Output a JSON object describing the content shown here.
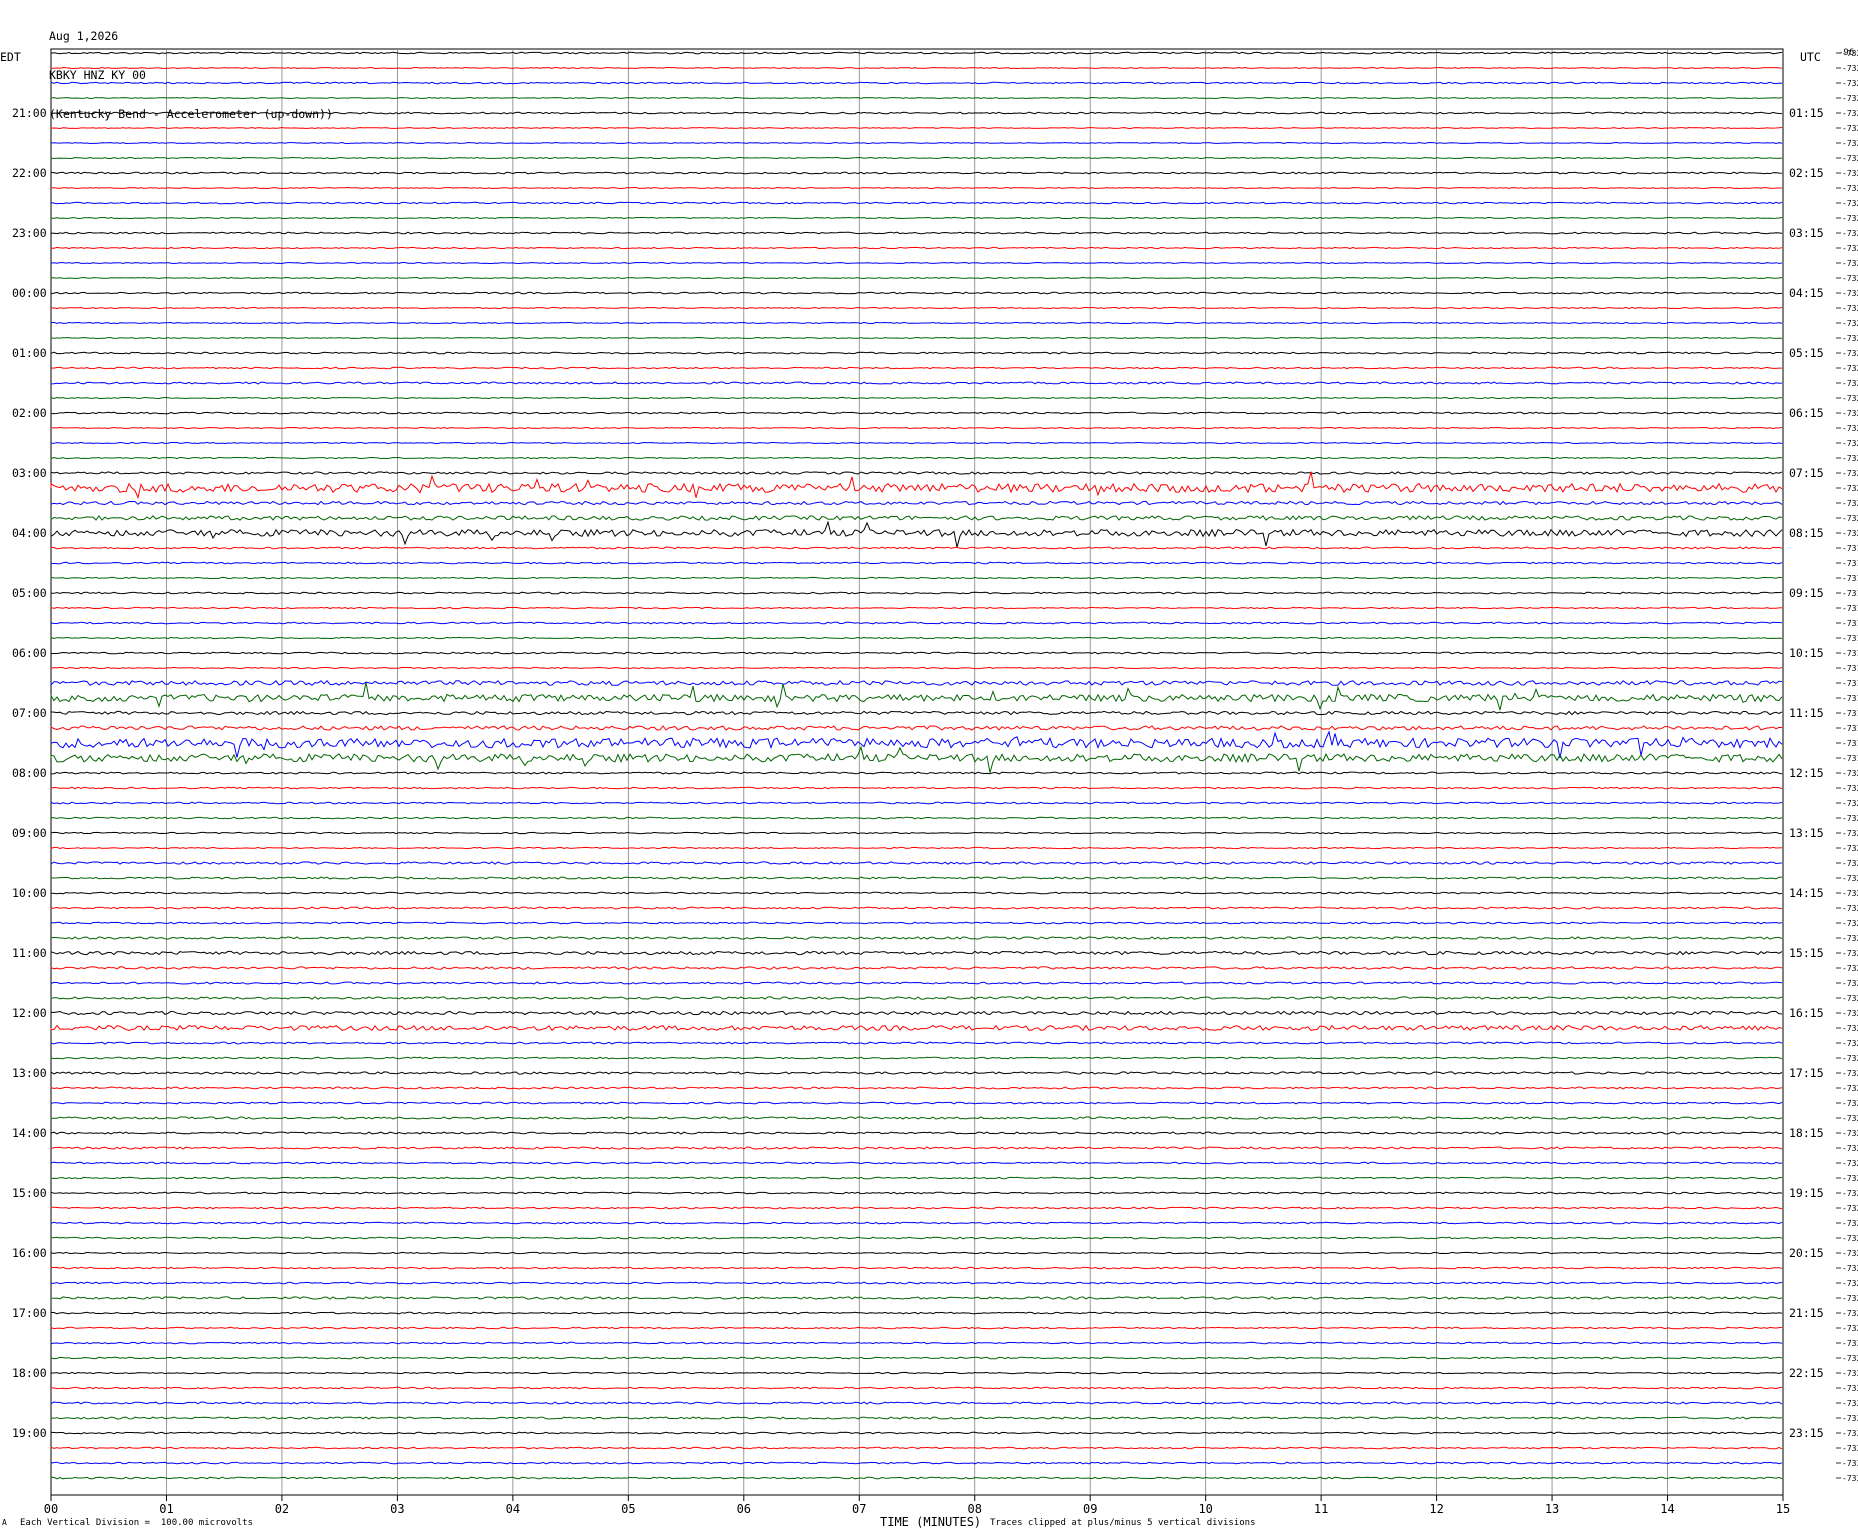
{
  "header": {
    "date": "Aug 1,2026",
    "station": "KBKY HNZ KY 00",
    "description": "(Kentucky Bend - Accelerometer (up-down))"
  },
  "left_tz": "EDT",
  "right_tz": "UTC",
  "corner_label": "-96",
  "footer": {
    "left_mark": "A",
    "scale_note": "Each Vertical Division =  100.00 microvolts",
    "xlabel": "TIME (MINUTES)",
    "clip_note": "Traces clipped at plus/minus 5 vertical divisions"
  },
  "colors": {
    "trace_cycle": [
      "#000000",
      "#ff0000",
      "#0000ff",
      "#006400"
    ],
    "grid": "#808080"
  },
  "chart_data": {
    "type": "line",
    "title": "KBKY HNZ KY 00 (Kentucky Bend - Accelerometer (up-down))",
    "xlabel": "TIME (MINUTES)",
    "xlim": [
      0,
      15
    ],
    "x_ticks": [
      "00",
      "01",
      "02",
      "03",
      "04",
      "05",
      "06",
      "07",
      "08",
      "09",
      "10",
      "11",
      "12",
      "13",
      "14",
      "15"
    ],
    "rows": 96,
    "minutes_per_row": 15,
    "left_hour_labels": [
      "21:00",
      "22:00",
      "23:00",
      "00:00",
      "01:00",
      "02:00",
      "03:00",
      "04:00",
      "05:00",
      "06:00",
      "07:00",
      "08:00",
      "09:00",
      "10:00",
      "11:00",
      "12:00",
      "13:00",
      "14:00",
      "15:00",
      "16:00",
      "17:00",
      "18:00",
      "19:00"
    ],
    "right_hour_labels": [
      "01:15",
      "02:15",
      "03:15",
      "04:15",
      "05:15",
      "06:15",
      "07:15",
      "08:15",
      "09:15",
      "10:15",
      "11:15",
      "12:15",
      "13:15",
      "14:15",
      "15:15",
      "16:15",
      "17:15",
      "18:15",
      "19:15",
      "20:15",
      "21:15",
      "22:15",
      "23:15"
    ],
    "row_offsets": [
      -7325,
      -7325,
      -7325,
      -7325,
      -7324,
      -7324,
      -7324,
      -7323,
      -7323,
      -7323,
      -7323,
      -7323,
      -7323,
      -7323,
      -7323,
      -7323,
      -7323,
      -7323,
      -7323,
      -7323,
      -7323,
      -7322,
      -7322,
      -7322,
      -7323,
      -7323,
      -7323,
      -7322,
      -7323,
      -7322,
      -7323,
      -7321,
      -7321,
      -7319,
      -7319,
      -7318,
      -7318,
      -7317,
      -7318,
      -7316,
      -7316,
      -7316,
      -7318,
      -7319,
      -7319,
      -7319,
      -7318,
      -7317,
      -7321,
      -7321,
      -7322,
      -7322,
      -7322,
      -7322,
      -7323,
      -7323,
      -7323,
      -7323,
      -7323,
      -7323,
      -7323,
      -7323,
      -7322,
      -7323,
      -7324,
      -7324,
      -7325,
      -7325,
      -7326,
      -7326,
      -7325,
      -7327,
      -7328,
      -7327,
      -7327,
      -7328,
      -7327,
      -7328,
      -7328,
      -7328,
      -7328,
      -7328,
      -7328,
      -7328,
      -7328,
      -7329,
      -7330,
      -7329,
      -7330,
      -7330,
      -7331,
      -7331,
      -7330,
      -7330,
      -7332,
      -7332,
      -7333,
      -7333,
      -7333,
      -7334
    ],
    "noise_level": [
      1.0,
      0.6,
      0.9,
      0.6,
      1.0,
      0.6,
      0.6,
      0.7,
      1.0,
      0.6,
      0.9,
      0.7,
      1.0,
      0.8,
      0.6,
      0.6,
      1.0,
      0.7,
      0.7,
      0.6,
      1.0,
      0.9,
      1.2,
      0.7,
      1.0,
      0.7,
      0.7,
      0.8,
      1.4,
      5.5,
      2.0,
      2.6,
      4.2,
      1.2,
      1.0,
      0.8,
      1.0,
      0.8,
      1.0,
      0.8,
      1.0,
      0.8,
      2.8,
      4.5,
      2.0,
      2.6,
      6.0,
      5.0,
      1.2,
      1.0,
      1.0,
      1.0,
      0.8,
      0.8,
      1.4,
      1.2,
      1.0,
      1.2,
      1.0,
      1.4,
      2.0,
      1.5,
      1.2,
      1.4,
      2.0,
      3.0,
      1.2,
      1.0,
      1.4,
      1.2,
      1.0,
      1.3,
      1.2,
      1.3,
      1.0,
      1.0,
      1.0,
      1.0,
      1.0,
      1.0,
      0.8,
      1.0,
      1.0,
      1.4,
      1.0,
      1.0,
      0.9,
      1.0,
      0.8,
      1.0,
      1.2,
      1.2,
      1.0,
      1.0,
      1.0,
      1.0,
      1.2,
      1.3,
      1.2,
      1.4
    ],
    "grid": true,
    "clip_divisions": 5,
    "scale_microvolts_per_division": 100.0
  }
}
